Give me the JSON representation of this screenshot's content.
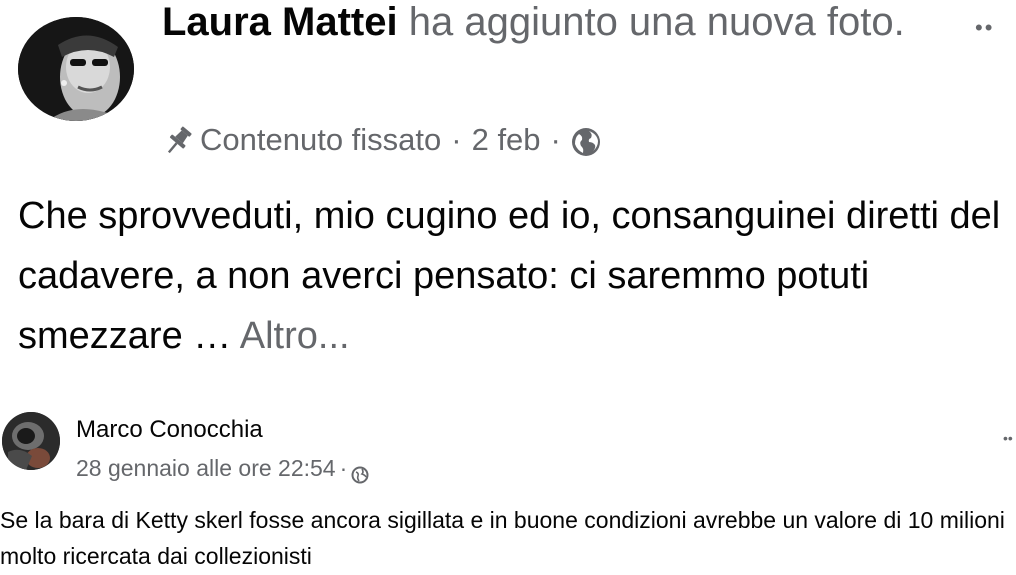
{
  "post": {
    "author": "Laura Mattei",
    "action": "ha aggiunto una nuova foto.",
    "pinned_label": "Contenuto fissato",
    "separator": "·",
    "date": "2 feb",
    "more_options": "••",
    "text": "Che sprovveduti, mio cugino ed io, consanguinei diretti del cadavere, a non averci pensato: ci saremmo potuti smezzare …",
    "see_more": "Altro...",
    "icons": {
      "avatar": "profile-photo",
      "pin": "pin-icon",
      "audience": "globe-icon"
    }
  },
  "embedded_post": {
    "author": "Marco Conocchia",
    "timestamp": "28 gennaio alle ore 22:54",
    "separator": "·",
    "more_options": "••",
    "text": "Se la bara di Ketty skerl fosse ancora sigillata e in buone condizioni avrebbe un valore di 10 milioni molto ricercata dai collezionisti",
    "icons": {
      "avatar": "profile-photo",
      "audience": "globe-icon"
    }
  },
  "colors": {
    "primary_text": "#050505",
    "secondary_text": "#65676b",
    "background": "#ffffff"
  }
}
